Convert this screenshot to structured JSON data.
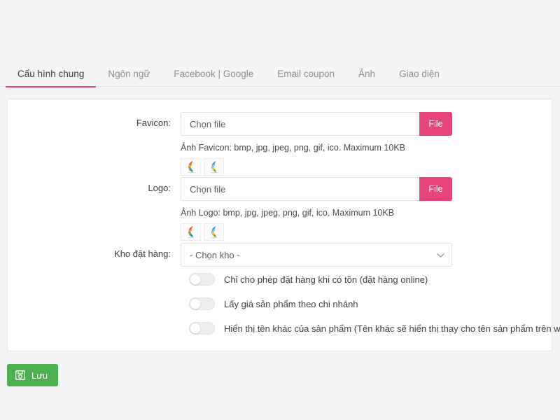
{
  "tabs": [
    {
      "label": "Cấu hình chung",
      "active": true
    },
    {
      "label": "Ngôn ngữ",
      "active": false
    },
    {
      "label": "Facebook | Google",
      "active": false
    },
    {
      "label": "Email coupon",
      "active": false
    },
    {
      "label": "Ảnh",
      "active": false
    },
    {
      "label": "Giao diện",
      "active": false
    }
  ],
  "form": {
    "favicon": {
      "label": "Favicon:",
      "placeholder": "Chọn file",
      "value": "",
      "button_label": "File",
      "hint": "Ảnh Favicon: bmp, jpg, jpeg, png, gif, ico. Maximum 10KB"
    },
    "logo": {
      "label": "Logo:",
      "placeholder": "Chọn file",
      "value": "",
      "button_label": "File",
      "hint": "Ảnh Logo: bmp, jpg, jpeg, png, gif, ico. Maximum 10KB"
    },
    "warehouse": {
      "label": "Kho đặt hàng:",
      "selected": "- Chọn kho -",
      "options": [
        "- Chọn kho -"
      ]
    },
    "toggles": [
      {
        "label": "Chỉ cho phép đặt hàng khi có tồn (đặt hàng online)",
        "on": false
      },
      {
        "label": "Lấy giá sản phẩm theo chi nhánh",
        "on": false
      },
      {
        "label": "Hiển thị tên khác của sản phẩm (Tên khác sẽ hiển thị thay cho tên sản phẩm trên website)",
        "on": false
      }
    ]
  },
  "save_button": {
    "label": "Lưu"
  },
  "colors": {
    "accent_pink": "#e8427a",
    "save_green": "#4caf50",
    "page_bg": "#f4f4f4",
    "card_bg": "#ffffff",
    "border": "#e0e0e0"
  }
}
